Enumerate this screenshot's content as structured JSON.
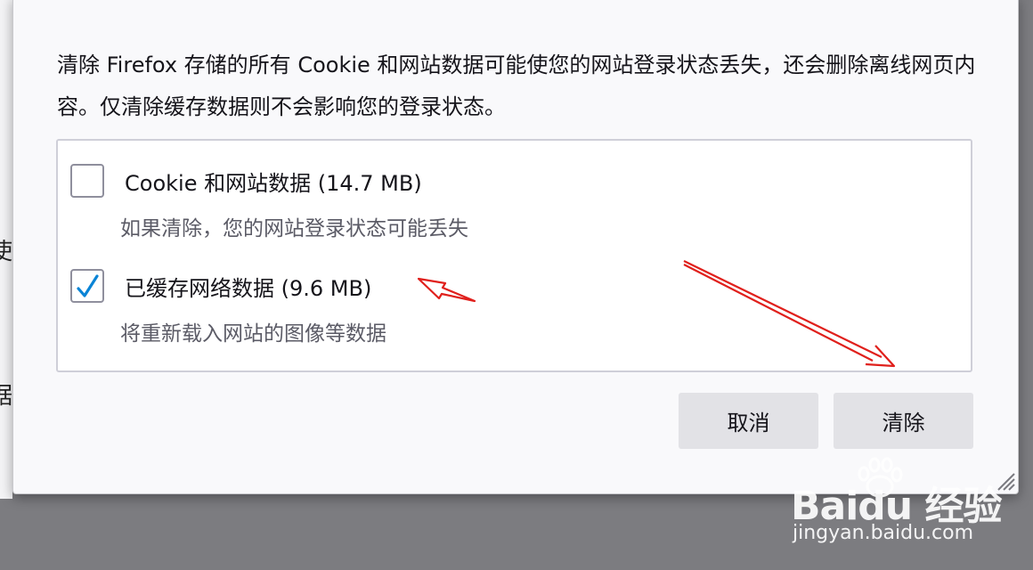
{
  "dialog": {
    "description": "清除 Firefox 存储的所有 Cookie 和网站数据可能使您的网站登录状态丢失，还会删除离线网页内容。仅清除缓存数据则不会影响您的登录状态。",
    "options": [
      {
        "label": "Cookie 和网站数据 (14.7 MB)",
        "sublabel": "如果清除，您的网站登录状态可能丢失",
        "checked": false
      },
      {
        "label": "已缓存网络数据 (9.6 MB)",
        "sublabel": "将重新载入网站的图像等数据",
        "checked": true
      }
    ],
    "cancel_label": "取消",
    "clear_label": "清除"
  },
  "background": {
    "fragment_1": "使",
    "fragment_2": "据"
  },
  "watermark": {
    "logo_text": "Baidu 经验",
    "url": "jingyan.baidu.com"
  },
  "colors": {
    "checkbox_accent": "#0a84d6",
    "annotation_arrow": "#e0201c",
    "button_bg": "#e2e2e6"
  },
  "icons": {
    "check": "checkmark-icon",
    "resize": "resize-grip-icon"
  }
}
